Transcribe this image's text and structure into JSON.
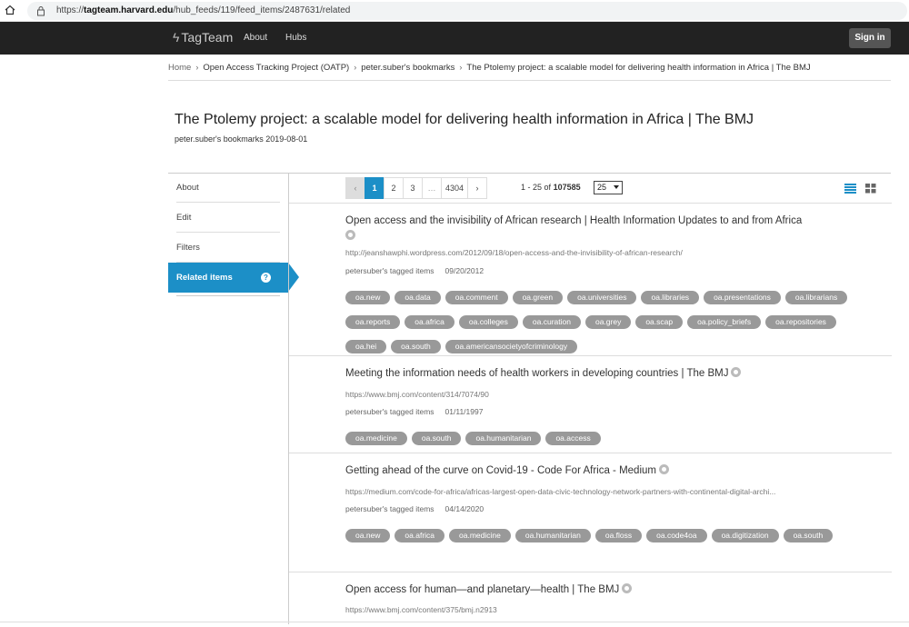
{
  "browser": {
    "url_prefix": "https://",
    "url_host": "tagteam.harvard.edu",
    "url_path": "/hub_feeds/119/feed_items/2487631/related"
  },
  "navbar": {
    "brand": "TagTeam",
    "links": [
      "About",
      "Hubs"
    ],
    "signin": "Sign in"
  },
  "breadcrumb": {
    "items": [
      "Home",
      "Open Access Tracking Project (OATP)",
      "peter.suber's bookmarks",
      "The Ptolemy project: a scalable model for delivering health information in Africa | The BMJ"
    ]
  },
  "page": {
    "title": "The Ptolemy project: a scalable model for delivering health information in Africa | The BMJ",
    "subtitle": "peter.suber's bookmarks 2019-08-01"
  },
  "menu": {
    "items": [
      "About",
      "Edit",
      "Filters",
      "Related items"
    ],
    "active": "Related items",
    "help_glyph": "?"
  },
  "pager": {
    "prev": "‹",
    "pages": [
      "1",
      "2",
      "3",
      "…",
      "4304"
    ],
    "next": "›",
    "range": "1 - 25",
    "of": "of",
    "total": "107585",
    "per_page": "25"
  },
  "items": [
    {
      "title": "Open access and the invisibility of African research | Health Information Updates to and from Africa",
      "url": "http://jeanshawphi.wordpress.com/2012/09/18/open-access-and-the-invisibility-of-african-research/",
      "source": "petersuber's tagged items",
      "date": "09/20/2012",
      "tags": [
        "oa.new",
        "oa.data",
        "oa.comment",
        "oa.green",
        "oa.universities",
        "oa.libraries",
        "oa.presentations",
        "oa.librarians",
        "oa.reports",
        "oa.africa",
        "oa.colleges",
        "oa.curation",
        "oa.grey",
        "oa.scap",
        "oa.policy_briefs",
        "oa.repositories",
        "oa.hei",
        "oa.south",
        "oa.americansocietyofcriminology"
      ]
    },
    {
      "title": "Meeting the information needs of health workers in developing countries | The BMJ",
      "url": "https://www.bmj.com/content/314/7074/90",
      "source": "petersuber's tagged items",
      "date": "01/11/1997",
      "tags": [
        "oa.medicine",
        "oa.south",
        "oa.humanitarian",
        "oa.access"
      ]
    },
    {
      "title": "Getting ahead of the curve on Covid-19 - Code For Africa - Medium",
      "url": "https://medium.com/code-for-africa/africas-largest-open-data-civic-technology-network-partners-with-continental-digital-archi...",
      "source": "petersuber's tagged items",
      "date": "04/14/2020",
      "tags": [
        "oa.new",
        "oa.africa",
        "oa.medicine",
        "oa.humanitarian",
        "oa.floss",
        "oa.code4oa",
        "oa.digitization",
        "oa.south"
      ]
    },
    {
      "title": "Open access for human—and planetary—health | The BMJ",
      "url": "https://www.bmj.com/content/375/bmj.n2913",
      "source": "",
      "date": "",
      "tags": []
    }
  ]
}
